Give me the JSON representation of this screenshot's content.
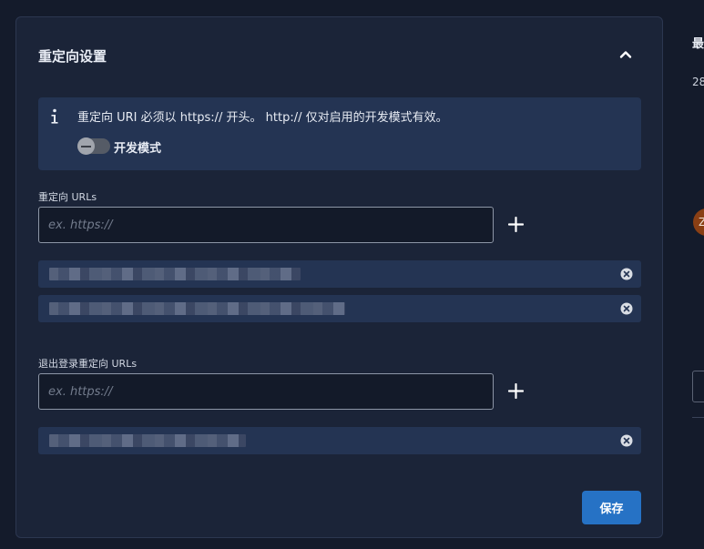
{
  "card": {
    "title": "重定向设置",
    "collapse_icon": "chevron-up-icon"
  },
  "info": {
    "icon": "info-icon",
    "message": "重定向 URI 必须以 https:// 开头。 http:// 仅对启用的开发模式有效。",
    "dev_mode_label": "开发模式",
    "dev_mode_enabled": false
  },
  "redirect": {
    "label": "重定向 URLs",
    "placeholder": "ex. https://",
    "value": "",
    "add_icon": "plus-icon",
    "entries": [
      {
        "redacted": true,
        "remove_icon": "remove-circle-icon"
      },
      {
        "redacted": true,
        "remove_icon": "remove-circle-icon"
      }
    ]
  },
  "logout": {
    "label": "退出登录重定向 URLs",
    "placeholder": "ex. https://",
    "value": "",
    "add_icon": "plus-icon",
    "entries": [
      {
        "redacted": true,
        "remove_icon": "remove-circle-icon"
      }
    ]
  },
  "actions": {
    "save_label": "保存"
  },
  "right_panel": {
    "heading": "最",
    "number": "28",
    "avatar_initial": "Z"
  },
  "colors": {
    "background": "#141b2b",
    "card": "#1b2438",
    "info_box": "#243453",
    "primary": "#2672c5"
  }
}
